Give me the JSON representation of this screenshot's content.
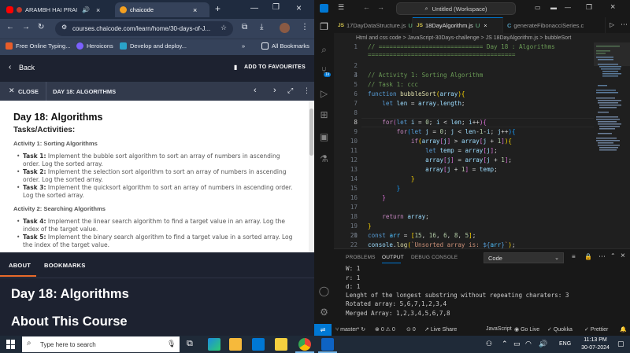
{
  "browser": {
    "tabs": [
      {
        "label": "ARAMBH HAI PRACHA",
        "icon": "youtube-icon"
      },
      {
        "label": "chaicode",
        "icon": "chaicode-icon"
      }
    ],
    "url": "courses.chaicode.com/learn/home/30-days-of-J...",
    "bookmarks": [
      {
        "label": "Free Online Typing...",
        "color": "#e85d2a"
      },
      {
        "label": "Heroicons",
        "color": "#7b61ff"
      },
      {
        "label": "Develop and deploy...",
        "color": "#2aa3c9"
      }
    ],
    "all_bookmarks": "All Bookmarks"
  },
  "course": {
    "back_label": "Back",
    "add_fav_label": "ADD TO FAVOURITES",
    "close_label": "CLOSE",
    "lesson_header": "DAY 18: ALGORITHMS",
    "title": "Day 18: Algorithms",
    "tasks_heading": "Tasks/Activities:",
    "activities": [
      {
        "heading": "Activity 1: Sorting Algorithms",
        "tasks": [
          {
            "name": "Task 1:",
            "text": "Implement the bubble sort algorithm to sort an array of numbers in ascending order. Log the sorted array."
          },
          {
            "name": "Task 2:",
            "text": "Implement the selection sort algorithm to sort an array of numbers in ascending order. Log the sorted array."
          },
          {
            "name": "Task 3:",
            "text": "Implement the quicksort algorithm to sort an array of numbers in ascending order. Log the sorted array."
          }
        ]
      },
      {
        "heading": "Activity 2: Searching Algorithms",
        "tasks": [
          {
            "name": "Task 4:",
            "text": "Implement the linear search algorithm to find a target value in an array. Log the index of the target value."
          },
          {
            "name": "Task 5:",
            "text": "Implement the binary search algorithm to find a target value in a sorted array. Log the index of the target value."
          }
        ]
      }
    ],
    "about_tabs": [
      "ABOUT",
      "BOOKMARKS"
    ],
    "about_title": "Day 18: Algorithms",
    "about_course": "About This Course"
  },
  "vscode": {
    "window_title": "Untitled (Workspace)",
    "tabs": [
      {
        "label": "17DayDataStructure.js",
        "badge": "U",
        "active": false
      },
      {
        "label": "18DayAlgorithm.js",
        "badge": "U",
        "active": true
      },
      {
        "label": "generateFibonacciSeries.c",
        "badge": "",
        "active": false
      }
    ],
    "breadcrumb": "Html and css code  >  JavaScript-30Days-challenge  >  JS 18DayAlgorithm.js  >  bubbleSort",
    "panel_tabs": [
      "PROBLEMS",
      "OUTPUT",
      "DEBUG CONSOLE"
    ],
    "panel_dropdown": "Code",
    "output_lines": [
      "W: 1",
      "r: 1",
      "d: 1",
      "Lenght of the longest substring without repeating charaters: 3",
      "Rotated array: 5,6,7,1,2,3,4",
      "Merged Array: 1,2,3,4,5,6,7,8"
    ],
    "status": {
      "branch": "master*",
      "errors": "0",
      "warnings": "0",
      "ports": "0",
      "live_share": "Live Share",
      "language": "JavaScript",
      "go_live": "Go Live",
      "quokka": "Quokka",
      "prettier": "Prettier"
    }
  },
  "taskbar": {
    "search_placeholder": "Type here to search",
    "lang": "ENG",
    "time": "11:13 PM",
    "date": "30-07-2024"
  }
}
